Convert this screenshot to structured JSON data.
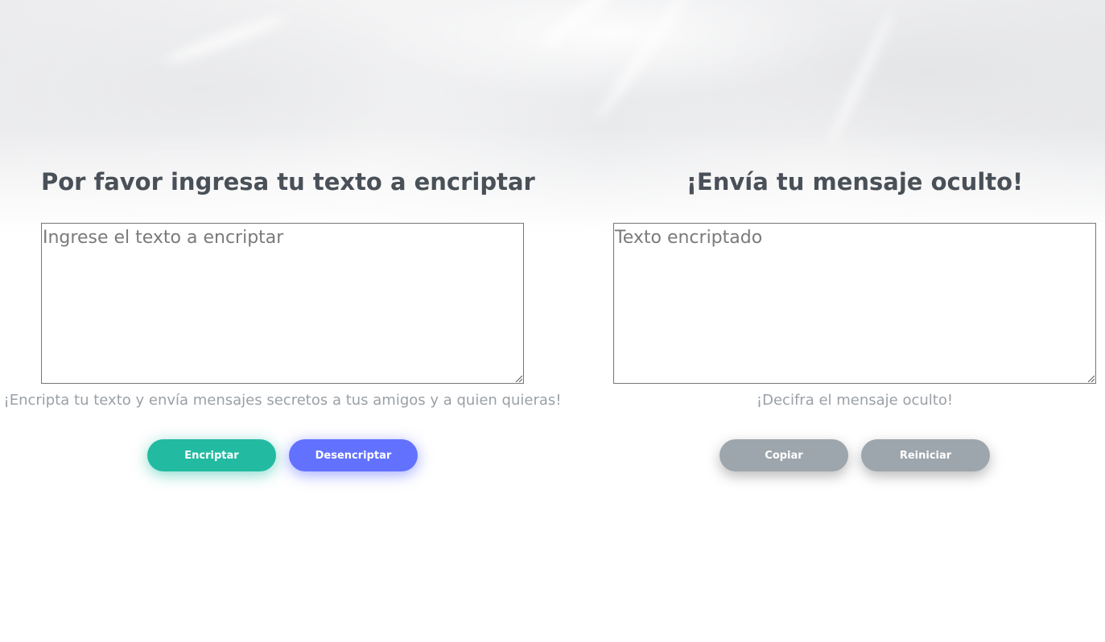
{
  "left_panel": {
    "title": "Por favor ingresa tu texto a encriptar",
    "input_placeholder": "Ingrese el texto a encriptar",
    "hint": "¡Encripta tu texto y envía mensajes secretos a tus amigos y a quien quieras!",
    "encrypt_label": "Encriptar",
    "decrypt_label": "Desencriptar"
  },
  "right_panel": {
    "title": "¡Envía tu mensaje oculto!",
    "output_placeholder": "Texto encriptado",
    "hint": "¡Decifra el mensaje oculto!",
    "copy_label": "Copiar",
    "reset_label": "Reiniciar"
  },
  "colors": {
    "heading": "#495057",
    "encrypt_button": "#22bba2",
    "decrypt_button": "#6272ff",
    "secondary_button": "#9ea6ad",
    "hint_text": "#9aa0a6"
  }
}
